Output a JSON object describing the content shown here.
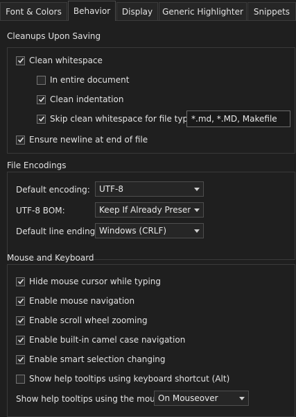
{
  "tabs": [
    {
      "label": "Font & Colors"
    },
    {
      "label": "Behavior"
    },
    {
      "label": "Display"
    },
    {
      "label": "Generic Highlighter"
    },
    {
      "label": "Snippets"
    }
  ],
  "cleanups": {
    "title": "Cleanups Upon Saving",
    "clean_whitespace": {
      "label": "Clean whitespace",
      "checked": true
    },
    "entire_document": {
      "label": "In entire document",
      "checked": false
    },
    "clean_indentation": {
      "label": "Clean indentation",
      "checked": true
    },
    "skip_clean": {
      "label": "Skip clean whitespace for file types:",
      "checked": true
    },
    "skip_types_value": "*.md, *.MD, Makefile",
    "ensure_newline": {
      "label": "Ensure newline at end of file",
      "checked": true
    }
  },
  "encodings": {
    "title": "File Encodings",
    "default_encoding_label": "Default encoding:",
    "default_encoding_value": "UTF-8",
    "bom_label": "UTF-8 BOM:",
    "bom_value": "Keep If Already Present",
    "line_endings_label": "Default line endings:",
    "line_endings_value": "Windows (CRLF)"
  },
  "mouse": {
    "title": "Mouse and Keyboard",
    "hide_cursor": {
      "label": "Hide mouse cursor while typing",
      "checked": true
    },
    "mouse_nav": {
      "label": "Enable mouse navigation",
      "checked": true
    },
    "scroll_zoom": {
      "label": "Enable scroll wheel zooming",
      "checked": true
    },
    "camel_case": {
      "label": "Enable built-in camel case navigation",
      "checked": true
    },
    "smart_selection": {
      "label": "Enable smart selection changing",
      "checked": true
    },
    "help_tooltips_keyboard": {
      "label": "Show help tooltips using keyboard shortcut (Alt)",
      "checked": false
    },
    "help_tooltips_mouse_label": "Show help tooltips using the mouse:",
    "help_tooltips_mouse_value": "On Mouseover"
  }
}
